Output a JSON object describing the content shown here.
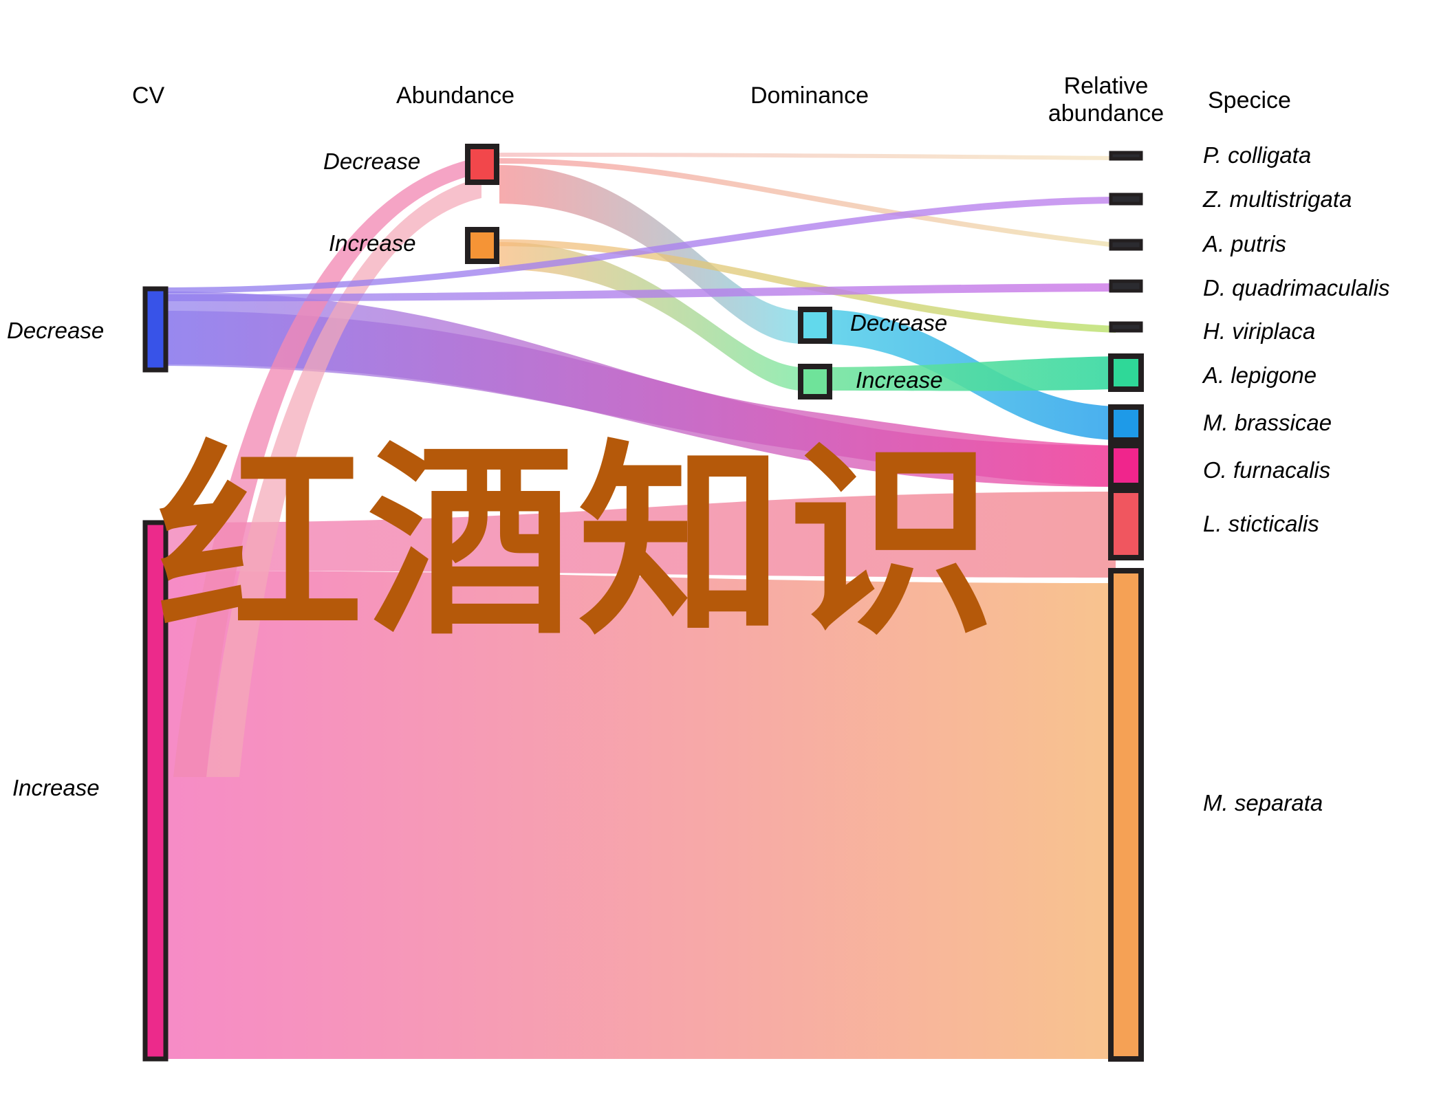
{
  "chart_data": {
    "type": "sankey",
    "title": "",
    "columns": [
      "CV",
      "Abundance",
      "Dominance",
      "Relative abundance",
      "Specice"
    ],
    "nodes": [
      {
        "id": "cv_decrease",
        "column": "CV",
        "label": "Decrease",
        "color": "#2f4fe0",
        "value": 15
      },
      {
        "id": "cv_increase",
        "column": "CV",
        "label": "Increase",
        "color": "#ec2a8b",
        "value": 70
      },
      {
        "id": "ab_decrease",
        "column": "Abundance",
        "label": "Decrease",
        "color": "#f0464a",
        "value": 8
      },
      {
        "id": "ab_increase",
        "column": "Abundance",
        "label": "Increase",
        "color": "#f5962f",
        "value": 5
      },
      {
        "id": "dom_decrease",
        "column": "Dominance",
        "label": "Decrease",
        "color": "#58d3e8",
        "value": 5
      },
      {
        "id": "dom_increase",
        "column": "Dominance",
        "label": "Increase",
        "color": "#64e08e",
        "value": 5
      },
      {
        "id": "ra_1",
        "column": "Relative abundance",
        "label": "",
        "color": "#2b2b30",
        "value": 0.5
      },
      {
        "id": "ra_2",
        "column": "Relative abundance",
        "label": "",
        "color": "#2b2b30",
        "value": 0.7
      },
      {
        "id": "ra_3",
        "column": "Relative abundance",
        "label": "",
        "color": "#2b2b30",
        "value": 0.7
      },
      {
        "id": "ra_4",
        "column": "Relative abundance",
        "label": "",
        "color": "#2b2b30",
        "value": 0.7
      },
      {
        "id": "ra_5",
        "column": "Relative abundance",
        "label": "",
        "color": "#2b2b30",
        "value": 0.5
      },
      {
        "id": "ra_6",
        "column": "Relative abundance",
        "label": "",
        "color": "#2fd898",
        "value": 3
      },
      {
        "id": "ra_7",
        "column": "Relative abundance",
        "label": "",
        "color": "#1e9ae8",
        "value": 3
      },
      {
        "id": "ra_8",
        "column": "Relative abundance",
        "label": "",
        "color": "#f0258c",
        "value": 3
      },
      {
        "id": "ra_9",
        "column": "Relative abundance",
        "label": "",
        "color": "#f0565f",
        "value": 5
      },
      {
        "id": "ra_10",
        "column": "Relative abundance",
        "label": "",
        "color": "#f5a155",
        "value": 60
      }
    ],
    "species": [
      {
        "name": "P. colligata",
        "node": "ra_1"
      },
      {
        "name": "Z. multistrigata",
        "node": "ra_2"
      },
      {
        "name": "A. putris",
        "node": "ra_3"
      },
      {
        "name": "D. quadrimaculalis",
        "node": "ra_4"
      },
      {
        "name": "H. viriplaca",
        "node": "ra_5"
      },
      {
        "name": "A. lepigone",
        "node": "ra_6"
      },
      {
        "name": "M. brassicae",
        "node": "ra_7"
      },
      {
        "name": "O. furnacalis",
        "node": "ra_8"
      },
      {
        "name": "L. sticticalis",
        "node": "ra_9"
      },
      {
        "name": "M. separata",
        "node": "ra_10"
      }
    ],
    "links": [
      {
        "source": "cv_decrease",
        "target": "ab_decrease",
        "value": 5
      },
      {
        "source": "cv_decrease",
        "target": "ab_increase",
        "value": 3
      },
      {
        "source": "cv_decrease",
        "target": "dom_decrease",
        "value": 4
      },
      {
        "source": "cv_decrease",
        "target": "dom_increase",
        "value": 4
      },
      {
        "source": "cv_decrease",
        "target": "ra_8",
        "value": 3
      },
      {
        "source": "cv_increase",
        "target": "ra_9",
        "value": 5
      },
      {
        "source": "cv_increase",
        "target": "ra_10",
        "value": 60
      },
      {
        "source": "ab_decrease",
        "target": "ra_1",
        "value": 0.5
      },
      {
        "source": "ab_decrease",
        "target": "ra_3",
        "value": 0.7
      },
      {
        "source": "ab_decrease",
        "target": "dom_decrease",
        "value": 3
      },
      {
        "source": "ab_increase",
        "target": "ra_5",
        "value": 1
      },
      {
        "source": "ab_increase",
        "target": "dom_increase",
        "value": 2
      },
      {
        "source": "dom_decrease",
        "target": "ra_7",
        "value": 3
      },
      {
        "source": "dom_increase",
        "target": "ra_6",
        "value": 3
      }
    ],
    "axis_note": "flow widths proportional to species counts",
    "legend_position": "none",
    "grid": false
  },
  "headers": {
    "cv": "CV",
    "abundance": "Abundance",
    "dominance": "Dominance",
    "relative_abundance_line1": "Relative",
    "relative_abundance_line2": "abundance",
    "specice": "Specice"
  },
  "cv_nodes": {
    "decrease": "Decrease",
    "increase": "Increase"
  },
  "abundance_nodes": {
    "decrease": "Decrease",
    "increase": "Increase"
  },
  "dominance_nodes": {
    "decrease": "Decrease",
    "increase": "Increase"
  },
  "species_labels": {
    "s1": "P. colligata",
    "s2": "Z. multistrigata",
    "s3": "A. putris",
    "s4": "D. quadrimaculalis",
    "s5": "H. viriplaca",
    "s6": "A. lepigone",
    "s7": "M. brassicae",
    "s8": "O. furnacalis",
    "s9": "L. sticticalis",
    "s10": "M. separata"
  },
  "watermark": {
    "text": "红酒知识",
    "color": "#B5590A"
  },
  "colors": {
    "cv_decrease": "#2f4fe0",
    "cv_increase": "#ec2a8b",
    "ab_decrease": "#f0464a",
    "ab_increase": "#f5962f",
    "dom_decrease": "#58d3e8",
    "dom_increase": "#64e08e",
    "ra_alepigone": "#2fd898",
    "ra_mbrassicae": "#1e9ae8",
    "ra_ofurnacalis": "#f0258c",
    "ra_lsticticalis": "#f0565f",
    "ra_mseparata": "#f5a155",
    "ra_small": "#2b2b30",
    "stroke": "#231f20",
    "background": "#ffffff"
  }
}
